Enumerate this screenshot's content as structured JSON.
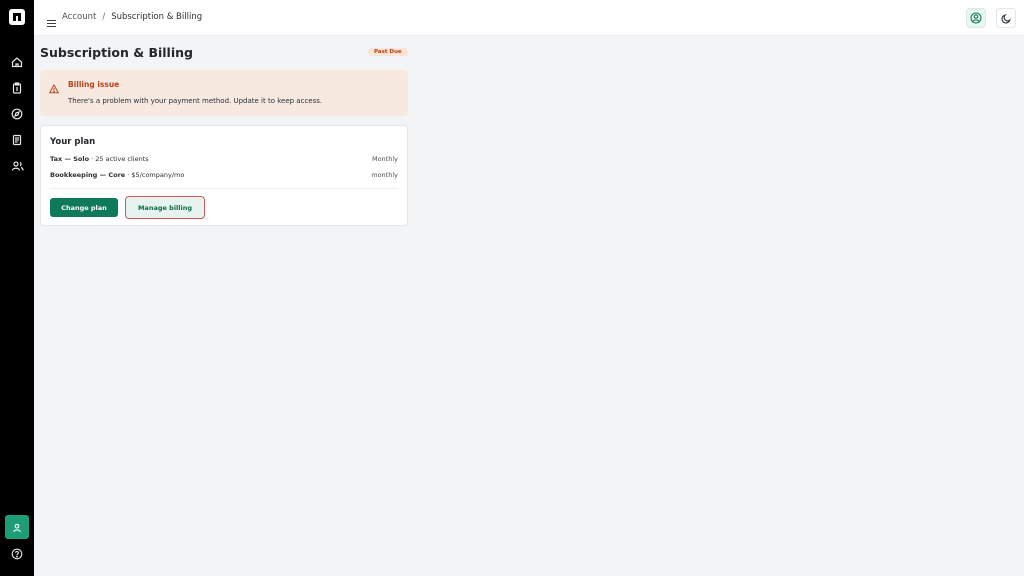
{
  "breadcrumb": {
    "root": "Account",
    "separator": "/",
    "current": "Subscription & Billing"
  },
  "page": {
    "title": "Subscription & Billing",
    "status_badge": "Past Due"
  },
  "alert": {
    "title": "Billing issue",
    "message": "There's a problem with your payment method. Update it to keep access."
  },
  "plan": {
    "title": "Your plan",
    "items": [
      {
        "name": "Tax — Solo",
        "detail": " · 25 active clients",
        "cycle": "Monthly"
      },
      {
        "name": "Bookkeeping — Core",
        "detail": " · $5/company/mo",
        "cycle": "monthly"
      }
    ],
    "change_label": "Change plan",
    "manage_label": "Manage billing"
  },
  "icons": {
    "rail": [
      "home-icon",
      "clipboard-icon",
      "compass-icon",
      "document-icon",
      "users-icon"
    ],
    "bottom": [
      "user-icon",
      "help-icon"
    ],
    "top": [
      "profile-icon",
      "moon-icon"
    ]
  },
  "colors": {
    "rail": "#000000",
    "primary": "#0f7a5a",
    "alert_bg": "#f7e9e0",
    "alert_text": "#b8431a",
    "badge_bg": "#fbe4d6",
    "focus_ring": "#d9535b"
  }
}
